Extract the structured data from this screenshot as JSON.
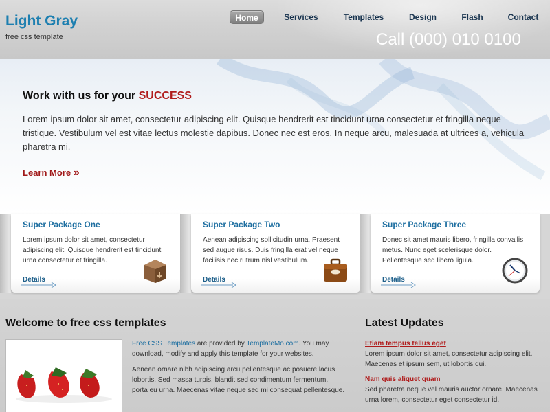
{
  "header": {
    "title": "Light Gray",
    "subtitle": "free css template",
    "phone": "Call (000) 010 0100"
  },
  "nav": {
    "items": [
      {
        "label": "Home",
        "active": true
      },
      {
        "label": "Services",
        "active": false
      },
      {
        "label": "Templates",
        "active": false
      },
      {
        "label": "Design",
        "active": false
      },
      {
        "label": "Flash",
        "active": false
      },
      {
        "label": "Contact",
        "active": false
      }
    ]
  },
  "banner": {
    "heading_prefix": "Work with us for your",
    "heading_accent": "SUCCESS",
    "body": "Lorem ipsum dolor sit amet, consectetur adipiscing elit. Quisque hendrerit est tincidunt urna consectetur et fringilla neque tristique. Vestibulum vel est vitae lectus molestie dapibus. Donec nec est eros. In neque arcu, malesuada at ultrices a, vehicula pharetra mi.",
    "learn_more": "Learn More",
    "learn_more_glyph": "»"
  },
  "packages": [
    {
      "title": "Super Package One",
      "body": "Lorem ipsum dolor sit amet, consectetur adipiscing elit. Quisque hendrerit est tincidunt urna consectetur et fringilla.",
      "details": "Details",
      "icon": "box-icon"
    },
    {
      "title": "Super Package Two",
      "body": "Aenean adipiscing sollicitudin urna. Praesent sed augue risus. Duis fringilla erat vel neque facilisis nec rutrum nisl vestibulum.",
      "details": "Details",
      "icon": "briefcase-icon"
    },
    {
      "title": "Super Package Three",
      "body": "Donec sit amet mauris libero, fringilla convallis metus. Nunc eget scelerisque dolor. Pellentesque sed libero ligula.",
      "details": "Details",
      "icon": "clock-icon"
    }
  ],
  "welcome": {
    "title": "Welcome to free css templates",
    "link1": "Free CSS Templates",
    "text1": " are provided by ",
    "link2": "TemplateMo.com",
    "text2": ". You may download, modify and apply this template for your websites.",
    "para2": "Aenean ornare nibh adipiscing arcu pellentesque ac posuere lacus lobortis. Sed massa turpis, blandit sed condimentum fermentum, porta eu urna. Maecenas vitae neque sed mi consequat pellentesque."
  },
  "updates": {
    "title": "Latest Updates",
    "items": [
      {
        "heading": "Etiam tempus tellus eget",
        "body": "Lorem ipsum dolor sit amet, consectetur adipiscing elit. Maecenas et ipsum sem, ut lobortis dui."
      },
      {
        "heading": "Nam quis aliquet quam",
        "body": "Sed pharetra neque vel mauris auctor ornare. Maecenas urna lorem, consectetur eget consectetur id."
      }
    ]
  },
  "colors": {
    "brand_blue": "#1d7fb0",
    "accent_red": "#b01c1c"
  }
}
